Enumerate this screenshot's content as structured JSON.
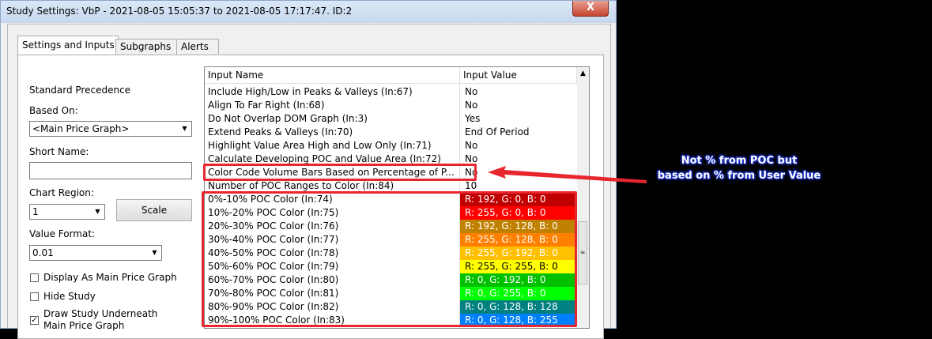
{
  "window": {
    "title": "Study Settings: VbP - 2021-08-05  15:05:37 to 2021-08-05  17:17:47. ID:2",
    "close_glyph": "X"
  },
  "tabs": [
    {
      "label": "Settings and Inputs"
    },
    {
      "label": "Subgraphs"
    },
    {
      "label": "Alerts"
    }
  ],
  "left": {
    "standard_precedence": "Standard Precedence",
    "based_on_label": "Based On:",
    "based_on_value": "<Main Price Graph>",
    "short_name_label": "Short Name:",
    "short_name_value": "",
    "chart_region_label": "Chart Region:",
    "chart_region_value": "1",
    "scale_button": "Scale",
    "value_format_label": "Value Format:",
    "value_format_value": "0.01",
    "checkboxes": [
      {
        "label": "Display As Main Price Graph",
        "checked": false,
        "mark": ""
      },
      {
        "label": "Hide Study",
        "checked": false,
        "mark": ""
      },
      {
        "label": "Draw Study Underneath",
        "label2": "Main Price Graph",
        "checked": true,
        "mark": "✓"
      }
    ]
  },
  "inputs": {
    "col_name": "Input Name",
    "col_value": "Input Value",
    "rows": [
      {
        "name": "Include High/Low in Peaks & Valleys   (In:67)",
        "value": "No"
      },
      {
        "name": "Align To Far Right   (In:68)",
        "value": "No"
      },
      {
        "name": "Do Not Overlap DOM Graph   (In:3)",
        "value": "Yes"
      },
      {
        "name": "Extend Peaks & Valleys   (In:70)",
        "value": "End Of Period"
      },
      {
        "name": "Highlight Value Area High and Low Only   (In:71)",
        "value": "No"
      },
      {
        "name": "Calculate Developing POC and Value Area   (In:72)",
        "value": "No"
      },
      {
        "name": "Color Code Volume Bars Based on Percentage of P...",
        "value": "No"
      },
      {
        "name": "Number of POC Ranges to Color   (In:84)",
        "value": "10"
      },
      {
        "name": "0%-10% POC Color   (In:74)",
        "value": "R: 192, G: 0, B: 0",
        "color": "#c00000",
        "text": "#ffffff"
      },
      {
        "name": "10%-20% POC Color   (In:75)",
        "value": "R: 255, G: 0, B: 0",
        "color": "#ff0000",
        "text": "#ffffff"
      },
      {
        "name": "20%-30% POC Color   (In:76)",
        "value": "R: 192, G: 128, B: 0",
        "color": "#c08000",
        "text": "#ffffff"
      },
      {
        "name": "30%-40% POC Color   (In:77)",
        "value": "R: 255, G: 128, B: 0",
        "color": "#ff8000",
        "text": "#ffffff"
      },
      {
        "name": "40%-50% POC Color   (In:78)",
        "value": "R: 255, G: 192, B: 0",
        "color": "#ffc000",
        "text": "#ffffff"
      },
      {
        "name": "50%-60% POC Color   (In:79)",
        "value": "R: 255, G: 255, B: 0",
        "color": "#ffff00",
        "text": "#000000"
      },
      {
        "name": "60%-70% POC Color   (In:80)",
        "value": "R: 0, G: 192, B: 0",
        "color": "#00c000",
        "text": "#ffffff"
      },
      {
        "name": "70%-80% POC Color   (In:81)",
        "value": "R: 0, G: 255, B: 0",
        "color": "#00ff00",
        "text": "#ffffff"
      },
      {
        "name": "80%-90% POC Color   (In:82)",
        "value": "R: 0, G: 128, B: 128",
        "color": "#008080",
        "text": "#ffffff"
      },
      {
        "name": "90%-100% POC Color   (In:83)",
        "value": "R: 0, G: 128, B: 255",
        "color": "#0080ff",
        "text": "#ffffff"
      }
    ]
  },
  "annotation": {
    "line1": "Not % from POC but",
    "line2": "based on % from User Value",
    "color": "#e8262e"
  }
}
